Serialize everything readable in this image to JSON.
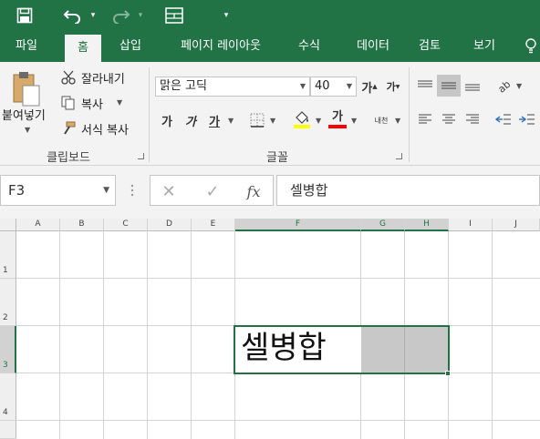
{
  "colors": {
    "brand": "#217346",
    "ribbon": "#f3f3f3",
    "selection_fill": "#c8c8c8"
  },
  "qat": {
    "icons": [
      "save-icon",
      "undo-icon",
      "redo-icon",
      "form-icon",
      "customize-icon"
    ]
  },
  "tabs": [
    "파일",
    "홈",
    "삽입",
    "페이지 레이아웃",
    "수식",
    "데이터",
    "검토",
    "보기"
  ],
  "active_tab": "홈",
  "clipboard": {
    "paste_label": "붙여넣기",
    "cut_label": "잘라내기",
    "copy_label": "복사",
    "format_painter_label": "서식 복사",
    "group_label": "클립보드"
  },
  "font": {
    "font_name": "맑은 고딕",
    "font_size": "40",
    "grow_label": "가",
    "shrink_label": "가",
    "bold_label": "가",
    "italic_label": "가",
    "underline_label": "가",
    "font_color_label": "가",
    "phonetic_label": "내천",
    "group_label": "글꼴",
    "highlight_color": "#ffff00",
    "font_color": "#ff0000"
  },
  "formula_bar": {
    "name_box": "F3",
    "cancel_symbol": "✕",
    "enter_symbol": "✓",
    "fx_label": "fx",
    "value": "셀병합"
  },
  "grid": {
    "columns": [
      "A",
      "B",
      "C",
      "D",
      "E",
      "F",
      "G",
      "H",
      "I",
      "J"
    ],
    "rows": [
      "1",
      "2",
      "3",
      "4"
    ],
    "selected_column": "F",
    "selected_row": "3",
    "merged_cell_text": "셀병합"
  }
}
